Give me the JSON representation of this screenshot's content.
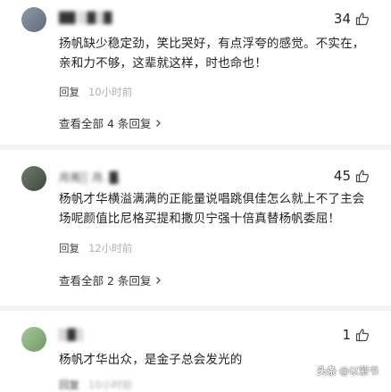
{
  "comments": [
    {
      "username": "██ ░█░█",
      "likes": "34",
      "text": "扬帆缺少稳定劲，笑比哭好，有点浮夸的感觉。不实在，亲和力不够，这辈就这样，时也命也！",
      "reply": "回复",
      "time": "10小时前",
      "view_replies": "查看全部 4 条回复"
    },
    {
      "username": "月亮░ 月. █.",
      "likes": "45",
      "text": "杨帆才华横溢满满的正能量说唱跳俱佳怎么就上不了主会场呢颜值比尼格买提和撒贝宁强十倍真替杨帆委屈！",
      "reply": "回复",
      "time": "12小时前",
      "view_replies": "查看全部 2 条回复"
    },
    {
      "username": "░█░",
      "likes": "1",
      "text": "杨帆才华出众，是金子总会发光的",
      "reply": "回复",
      "time": "10小时前"
    }
  ],
  "watermark": {
    "brand": "头条",
    "handle": "@以萦书"
  },
  "icons": {
    "like": "thumbs-up-icon",
    "chevron": "chevron-right-icon"
  }
}
